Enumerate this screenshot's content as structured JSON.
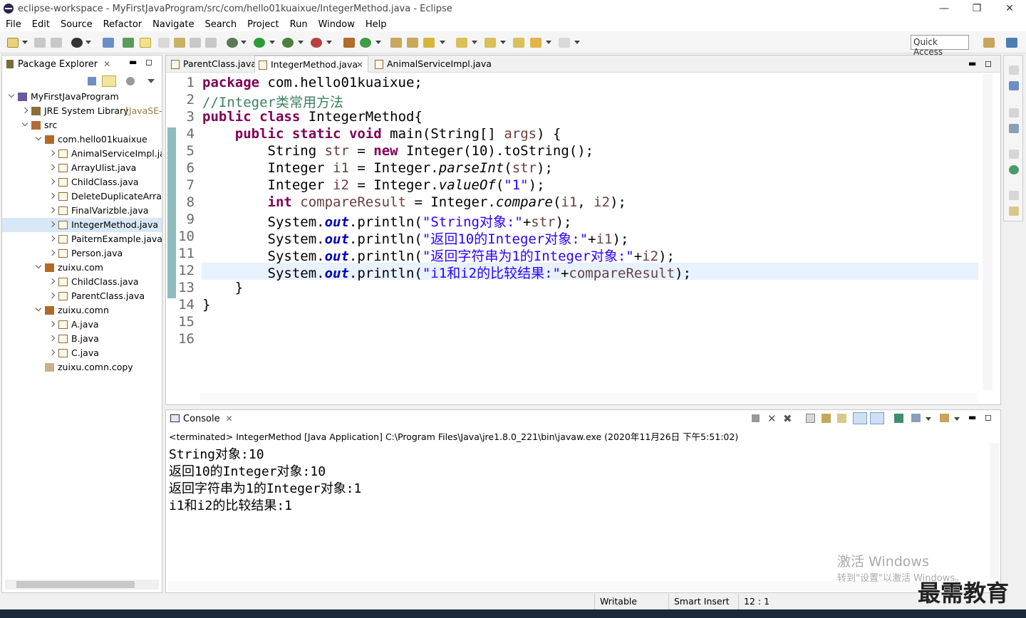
{
  "window": {
    "title": "eclipse-workspace - MyFirstJavaProgram/src/com/hello01kuaixue/IntegerMethod.java - Eclipse"
  },
  "menu": [
    "File",
    "Edit",
    "Source",
    "Refactor",
    "Navigate",
    "Search",
    "Project",
    "Run",
    "Window",
    "Help"
  ],
  "quick_access": "Quick Access",
  "package_explorer": {
    "title": "Package Explorer",
    "items": [
      {
        "label": "MyFirstJavaProgram",
        "level": 0,
        "twisty": "open",
        "icon": "project-icon"
      },
      {
        "label": "JRE System Library",
        "suffix": "[JavaSE-",
        "level": 1,
        "twisty": "closed",
        "icon": "library-icon"
      },
      {
        "label": "src",
        "level": 1,
        "twisty": "open",
        "icon": "source-folder-icon"
      },
      {
        "label": "com.hello01kuaixue",
        "level": 2,
        "twisty": "open",
        "icon": "package-icon"
      },
      {
        "label": "AnimalServiceImpl.ja",
        "level": 3,
        "twisty": "closed",
        "icon": "java-file-icon"
      },
      {
        "label": "ArrayUlist.java",
        "level": 3,
        "twisty": "closed",
        "icon": "java-file-icon"
      },
      {
        "label": "ChildClass.java",
        "level": 3,
        "twisty": "closed",
        "icon": "java-file-icon"
      },
      {
        "label": "DeleteDuplicateArray",
        "level": 3,
        "twisty": "closed",
        "icon": "java-file-icon"
      },
      {
        "label": "FinalVarizble.java",
        "level": 3,
        "twisty": "closed",
        "icon": "java-file-icon"
      },
      {
        "label": "IntegerMethod.java",
        "level": 3,
        "twisty": "closed",
        "icon": "java-file-icon",
        "selected": true
      },
      {
        "label": "PaiternExample.java",
        "level": 3,
        "twisty": "closed",
        "icon": "java-file-icon"
      },
      {
        "label": "Person.java",
        "level": 3,
        "twisty": "closed",
        "icon": "java-file-icon"
      },
      {
        "label": "zuixu.com",
        "level": 2,
        "twisty": "open",
        "icon": "package-icon"
      },
      {
        "label": "ChildClass.java",
        "level": 3,
        "twisty": "closed",
        "icon": "java-file-icon"
      },
      {
        "label": "ParentClass.java",
        "level": 3,
        "twisty": "closed",
        "icon": "java-file-icon"
      },
      {
        "label": "zuixu.comn",
        "level": 2,
        "twisty": "open",
        "icon": "package-icon"
      },
      {
        "label": "A.java",
        "level": 3,
        "twisty": "closed",
        "icon": "java-file-icon"
      },
      {
        "label": "B.java",
        "level": 3,
        "twisty": "closed",
        "icon": "java-file-icon"
      },
      {
        "label": "C.java",
        "level": 3,
        "twisty": "closed",
        "icon": "java-file-icon"
      },
      {
        "label": "zuixu.comn.copy",
        "level": 2,
        "twisty": "none",
        "icon": "empty-package-icon"
      }
    ]
  },
  "editor": {
    "tabs": [
      {
        "label": "ParentClass.java",
        "active": false
      },
      {
        "label": "IntegerMethod.java",
        "active": true
      },
      {
        "label": "AnimalServiceImpl.java",
        "active": false
      }
    ],
    "line_numbers": [
      "1",
      "2",
      "3",
      "4",
      "5",
      "6",
      "7",
      "8",
      "9",
      "10",
      "11",
      "12",
      "13",
      "14",
      "15",
      "16"
    ],
    "code": {
      "l1_kw": "package",
      "l1_rest": " com.hello01kuaixue;",
      "l2": "//Integer类常用方法",
      "l3_kw1": "public",
      "l3_kw2": "class",
      "l3_rest": " IntegerMethod{",
      "l4_kw1": "public",
      "l4_kw2": "static",
      "l4_kw3": "void",
      "l4_a": " main(String[] ",
      "l4_var": "args",
      "l4_b": ") {",
      "l5_a": "String ",
      "l5_var": "str",
      "l5_b": " = ",
      "l5_kw": "new",
      "l5_c": " Integer(10).toString();",
      "l6_a": "Integer ",
      "l6_var": "i1",
      "l6_b": " = Integer.",
      "l6_m": "parseInt",
      "l6_c": "(",
      "l6_var2": "str",
      "l6_d": ");",
      "l7_a": "Integer ",
      "l7_var": "i2",
      "l7_b": " = Integer.",
      "l7_m": "valueOf",
      "l7_c": "(",
      "l7_s": "\"1\"",
      "l7_d": ");",
      "l8_kw": "int",
      "l8_a": " ",
      "l8_var": "compareResult",
      "l8_b": " = Integer.",
      "l8_m": "compare",
      "l8_c": "(",
      "l8_var2": "i1",
      "l8_d": ", ",
      "l8_var3": "i2",
      "l8_e": ");",
      "l9_a": "System.",
      "l9_f": "out",
      "l9_b": ".println(",
      "l9_s": "\"String对象:\"",
      "l9_c": "+",
      "l9_var": "str",
      "l9_d": ");",
      "l10_a": "System.",
      "l10_f": "out",
      "l10_b": ".println(",
      "l10_s": "\"返回10的Integer对象:\"",
      "l10_c": "+",
      "l10_var": "i1",
      "l10_d": ");",
      "l11_a": "System.",
      "l11_f": "out",
      "l11_b": ".println(",
      "l11_s": "\"返回字符串为1的Integer对象:\"",
      "l11_c": "+",
      "l11_var": "i2",
      "l11_d": ");",
      "l12_a": "System.",
      "l12_f": "out",
      "l12_b": ".println(",
      "l12_s": "\"i1和i2的比较结果:\"",
      "l12_c": "+",
      "l12_var": "compareResult",
      "l12_d": ");",
      "l13": "}",
      "l14": "}"
    }
  },
  "console": {
    "title": "Console",
    "terminated": "<terminated> IntegerMethod [Java Application] C:\\Program Files\\Java\\jre1.8.0_221\\bin\\javaw.exe (2020年11月26日 下午5:51:02)",
    "lines": [
      "String对象:10",
      "返回10的Integer对象:10",
      "返回字符串为1的Integer对象:1",
      "i1和i2的比较结果:1"
    ]
  },
  "status": {
    "writable": "Writable",
    "insert": "Smart Insert",
    "position": "12 : 1"
  },
  "watermark": {
    "line1": "激活 Windows",
    "line2": "转到\"设置\"以激活 Windows。",
    "brand": "最需教育"
  }
}
